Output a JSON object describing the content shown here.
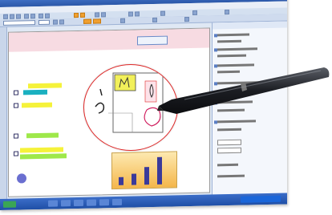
{
  "app": {
    "title": ""
  },
  "menubar": {
    "items": [
      "",
      "",
      "",
      "",
      "",
      "",
      "",
      "",
      "",
      ""
    ]
  },
  "slide": {
    "title": "",
    "bullets": [
      "",
      "",
      "",
      "",
      "",
      "",
      "",
      "",
      ""
    ]
  },
  "colors": {
    "highlight_yellow": "#f5f23a",
    "highlight_green": "#9ee84a",
    "highlight_teal": "#1ab0c0",
    "magnifier_circle": "#e02828",
    "title_pink": "#f7dbe2",
    "chart_bar": "#3a3a9a"
  },
  "icons": [
    "pen-stylus-icon",
    "magnifier-circle"
  ]
}
